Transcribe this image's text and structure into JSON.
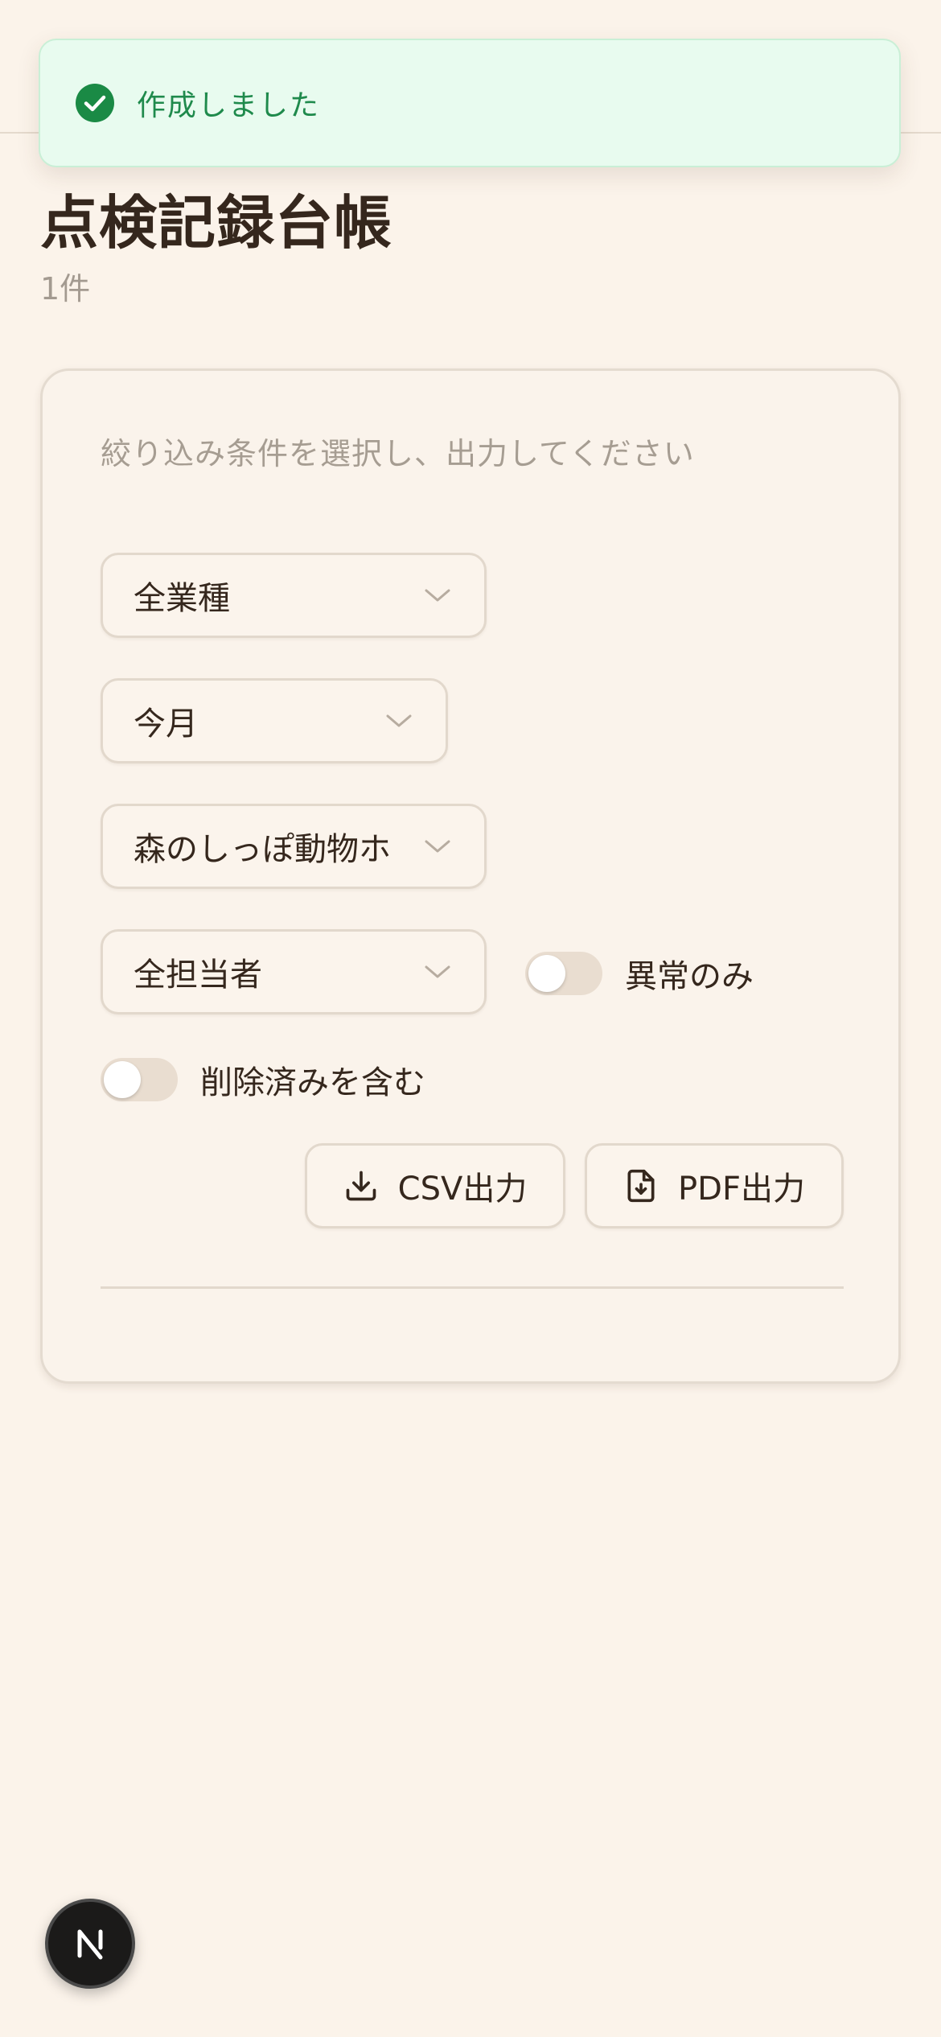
{
  "toast": {
    "message": "作成しました",
    "icon": "check-circle-icon",
    "color": "#1f8a4c"
  },
  "page": {
    "title": "点検記録台帳",
    "count": "1件"
  },
  "filters": {
    "instructions": "絞り込み条件を選択し、出力してください",
    "industry": {
      "value": "全業種"
    },
    "period": {
      "value": "今月"
    },
    "facility": {
      "value": "森のしっぽ動物ホ"
    },
    "staff": {
      "value": "全担当者"
    },
    "abnormal_only": {
      "label": "異常のみ",
      "checked": false
    },
    "include_deleted": {
      "label": "削除済みを含む",
      "checked": false
    }
  },
  "actions": {
    "csv_label": "CSV出力",
    "pdf_label": "PDF出力"
  },
  "dev_badge": {
    "icon": "nextjs-n-icon"
  },
  "colors": {
    "background": "#fbf3ea",
    "text": "#35271d",
    "muted": "#a39a90",
    "success": "#1f8a4c"
  }
}
